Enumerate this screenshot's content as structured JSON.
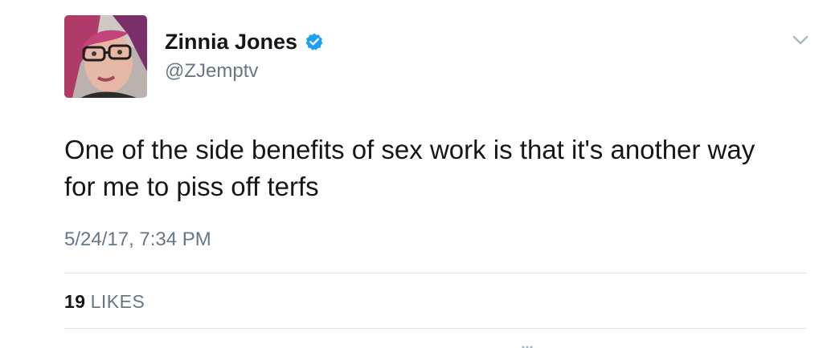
{
  "author": {
    "display_name": "Zinnia Jones",
    "handle": "@ZJemptv",
    "verified": true,
    "avatar_icon": "avatar-photo"
  },
  "tweet": {
    "text": "One of the side benefits of sex work is that it's another way for me to piss off terfs",
    "timestamp": "5/24/17, 7:34 PM"
  },
  "stats": {
    "likes_count": "19",
    "likes_label": "LIKES"
  },
  "icons": {
    "verified": "verified-badge-icon",
    "menu": "chevron-down-icon"
  },
  "colors": {
    "text_primary": "#14171a",
    "text_secondary": "#657786",
    "verified_blue": "#1da1f2",
    "divider": "#e1e8ed"
  }
}
